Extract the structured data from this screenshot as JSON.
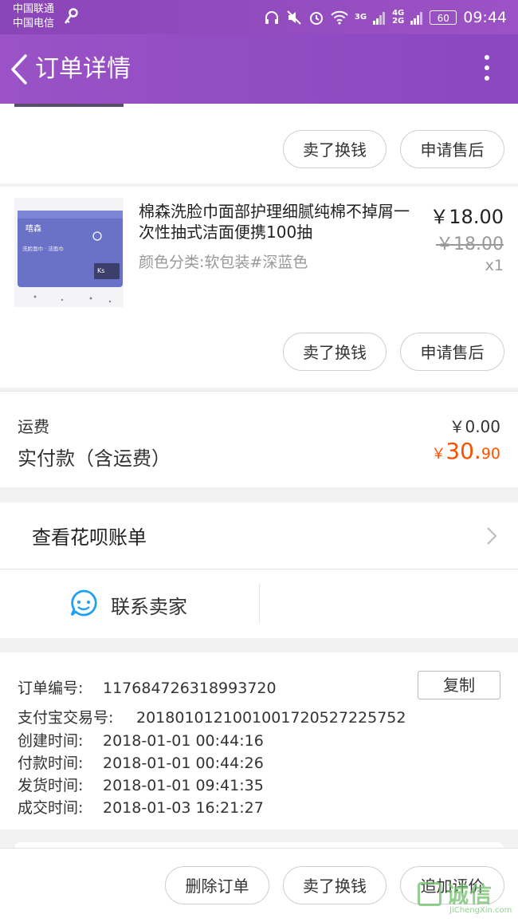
{
  "status_bar": {
    "carrier_1": "中国联通",
    "carrier_2": "中国电信",
    "net_1": "3G",
    "net_2a": "4G",
    "net_2b": "2G",
    "battery": "60",
    "time": "09:44"
  },
  "header": {
    "title": "订单详情"
  },
  "item_1": {
    "sell_label": "卖了换钱",
    "after_sale_label": "申请售后"
  },
  "item_2": {
    "name": "棉森洗脸巾面部护理细腻纯棉不掉屑一次性抽式洁面便携100抽",
    "spec": "颜色分类:软包装#深蓝色",
    "price": "￥18.00",
    "original_price": "￥18.00",
    "quantity": "x1",
    "image_text_1": "嘻森",
    "image_text_2": "洗脸面巾 · 洁面巾",
    "image_text_3": "Ks",
    "sell_label": "卖了换钱",
    "after_sale_label": "申请售后"
  },
  "summary": {
    "shipping_label": "运费",
    "shipping_value": "￥0.00",
    "total_label": "实付款（含运费）",
    "total_currency": "￥",
    "total_int": "30.",
    "total_dec": "90"
  },
  "huabei": {
    "label": "查看花呗账单"
  },
  "contact": {
    "label": "联系卖家"
  },
  "order_info": {
    "order_no_label": "订单编号:",
    "order_no": "117684726318993720",
    "copy_label": "复制",
    "alipay_label": "支付宝交易号:",
    "alipay_no": "2018010121001001720527225752",
    "created_label": "创建时间:",
    "created": "2018-01-01 00:44:16",
    "paid_label": "付款时间:",
    "paid": "2018-01-01 00:44:26",
    "shipped_label": "发货时间:",
    "shipped": "2018-01-01 09:41:35",
    "completed_label": "成交时间:",
    "completed": "2018-01-03 16:21:27"
  },
  "bottom_bar": {
    "delete_label": "删除订单",
    "sell_label": "卖了换钱",
    "review_label": "追加评价"
  },
  "watermark": {
    "text": "诚信",
    "sub": "JiChengXin.com"
  },
  "colors": {
    "accent": "#9a52c6",
    "price_orange": "#ff5000",
    "contact_blue": "#1ea1f1"
  }
}
